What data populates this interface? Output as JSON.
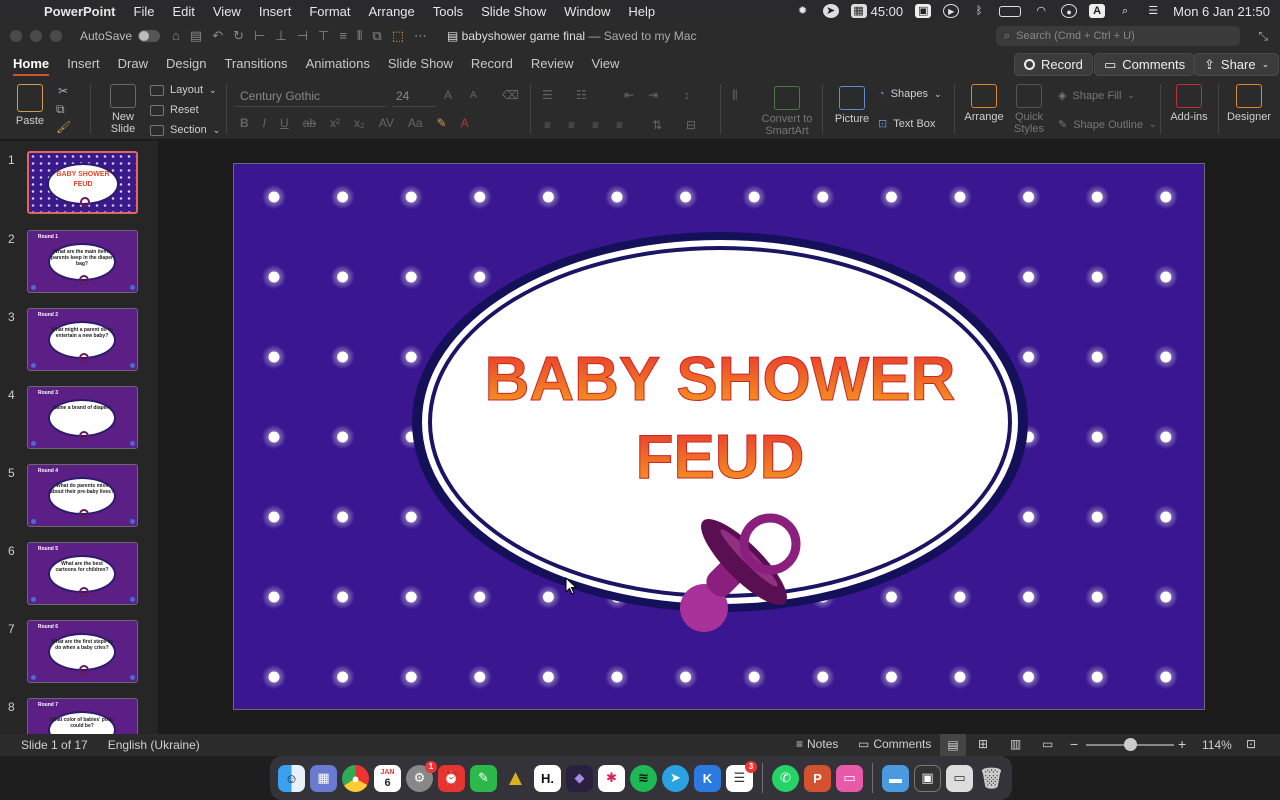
{
  "menubar": {
    "app_name": "PowerPoint",
    "items": [
      "File",
      "Edit",
      "View",
      "Insert",
      "Format",
      "Arrange",
      "Tools",
      "Slide Show",
      "Window",
      "Help"
    ],
    "timer": "45:00",
    "datetime": "Mon 6 Jan  21:50"
  },
  "titlebar": {
    "autosave_label": "AutoSave",
    "doc_name": "babyshower game final",
    "saved_status": "— Saved to my Mac",
    "search_placeholder": "Search (Cmd + Ctrl + U)"
  },
  "ribbon_tabs": [
    "Home",
    "Insert",
    "Draw",
    "Design",
    "Transitions",
    "Animations",
    "Slide Show",
    "Record",
    "Review",
    "View"
  ],
  "ribbon_buttons": {
    "record": "Record",
    "comments": "Comments",
    "share": "Share"
  },
  "ribbon": {
    "paste": "Paste",
    "new_slide_1": "New",
    "new_slide_2": "Slide",
    "layout": "Layout",
    "reset": "Reset",
    "section": "Section",
    "font_name": "Century Gothic",
    "font_size": "24",
    "convert_1": "Convert to",
    "convert_2": "SmartArt",
    "picture": "Picture",
    "shapes": "Shapes",
    "text_box": "Text Box",
    "arrange": "Arrange",
    "quick_styles_1": "Quick",
    "quick_styles_2": "Styles",
    "shape_fill": "Shape Fill",
    "shape_outline": "Shape Outline",
    "addins": "Add-ins",
    "designer": "Designer"
  },
  "slides": [
    {
      "num": "1",
      "title_line1": "BABY SHOWER",
      "title_line2": "FEUD"
    },
    {
      "num": "2",
      "round": "Round 1",
      "question": "What are the main items parents keep in the diaper bag?"
    },
    {
      "num": "3",
      "round": "Round 2",
      "question": "What might a parent do to entertain a new baby?"
    },
    {
      "num": "4",
      "round": "Round 3",
      "question": "Name a brand of diapers"
    },
    {
      "num": "5",
      "round": "Round 4",
      "question": "What do parents miss about their pre-baby lives?"
    },
    {
      "num": "6",
      "round": "Round 5",
      "question": "What are the best cartoons for children?"
    },
    {
      "num": "7",
      "round": "Round 6",
      "question": "What are the first steps to do when a baby cries?"
    },
    {
      "num": "8",
      "round": "Round 7",
      "question": "What color of babies' poop could be?"
    }
  ],
  "main_slide": {
    "title_line1": "BABY SHOWER",
    "title_line2": "FEUD",
    "background_color": "#3a1790",
    "title_gradient_top": "#e8342e",
    "title_gradient_bottom": "#f6a21e"
  },
  "statusbar": {
    "slide_info": "Slide 1 of 17",
    "language": "English (Ukraine)",
    "notes": "Notes",
    "comments": "Comments",
    "zoom": "114%"
  },
  "dock": {
    "calendar_month": "JAN",
    "calendar_day": "6",
    "badge_settings": "1",
    "badge_tasks": "3"
  }
}
